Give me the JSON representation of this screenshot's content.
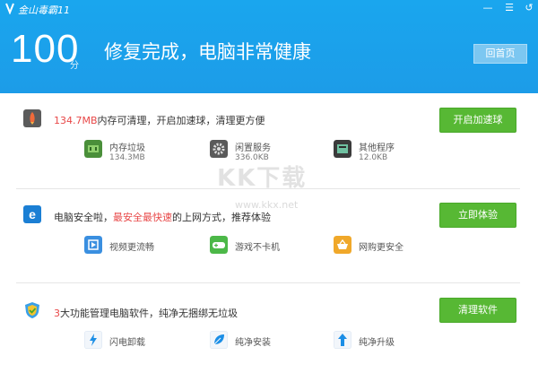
{
  "window": {
    "title": "金山毒霸11",
    "min_icon": "minimize-icon",
    "menu_icon": "menu-icon",
    "close_icon": "close-icon"
  },
  "header": {
    "score": "100",
    "score_unit": "分",
    "headline": "修复完成，电脑非常健康",
    "home_button": "回首页"
  },
  "sections": [
    {
      "icon": "rocket-icon",
      "highlight": "134.7MB",
      "text": "内存可清理，开启加速球，清理更方便",
      "button": "开启加速球",
      "features": [
        {
          "icon": "memory-chip-icon",
          "label": "内存垃圾",
          "sub": "134.3MB"
        },
        {
          "icon": "gear-icon",
          "label": "闲置服务",
          "sub": "336.0KB"
        },
        {
          "icon": "program-icon",
          "label": "其他程序",
          "sub": "12.0KB"
        }
      ]
    },
    {
      "icon": "browser-e-icon",
      "text_pre": "电脑安全啦，",
      "highlight": "最安全最快速",
      "text_post": "的上网方式，推荐体验",
      "button": "立即体验",
      "features": [
        {
          "icon": "video-icon",
          "label": "视频更流畅"
        },
        {
          "icon": "gamepad-icon",
          "label": "游戏不卡机"
        },
        {
          "icon": "shopping-basket-icon",
          "label": "网购更安全"
        }
      ]
    },
    {
      "icon": "shield-icon",
      "highlight": "3",
      "text": "大功能管理电脑软件，纯净无捆绑无垃圾",
      "button": "清理软件",
      "features": [
        {
          "icon": "lightning-icon",
          "label": "闪电卸载"
        },
        {
          "icon": "leaf-icon",
          "label": "纯净安装"
        },
        {
          "icon": "upgrade-arrow-icon",
          "label": "纯净升级"
        }
      ]
    }
  ],
  "watermark": {
    "text": "KK下载",
    "sub": "www.kkx.net"
  },
  "colors": {
    "header_blue": "#1c9ce8",
    "button_green": "#57b834",
    "highlight_red": "#e84848"
  }
}
